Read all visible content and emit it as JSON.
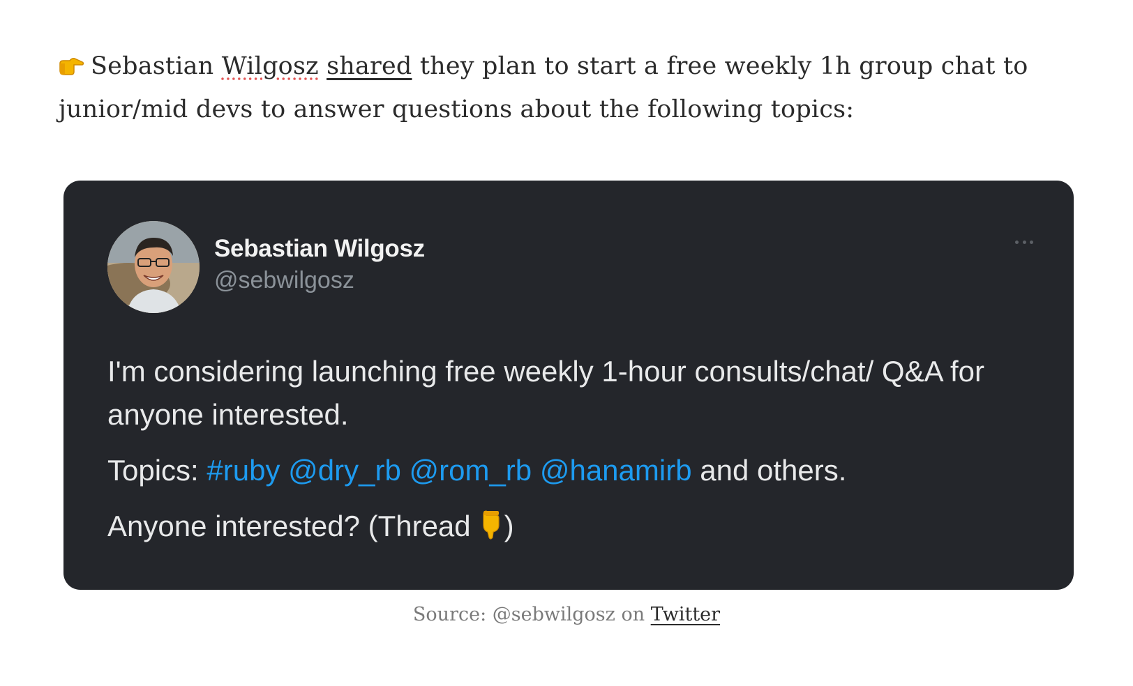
{
  "intro": {
    "pointer_icon": "backhand-index-pointing-right-icon",
    "name": "Sebastian",
    "surname_link": "Wilgosz",
    "shared_link": "shared",
    "text": " they plan to start a free weekly 1h group chat to junior/mid devs to answer questions about the following topics:"
  },
  "tweet": {
    "author_name": "Sebastian Wilgosz",
    "author_handle": "@sebwilgosz",
    "line1": "I'm considering launching free weekly 1-hour consults/chat/ Q&A for anyone interested.",
    "topics_prefix": "Topics: ",
    "tags": [
      "#ruby",
      "@dry_rb",
      "@rom_rb",
      "@hanamirb"
    ],
    "topics_suffix": " and others.",
    "question_text": "Anyone interested? (Thread",
    "question_end": ")",
    "finger_icon": "backhand-index-pointing-down-icon",
    "accent_color": "#1d9bf0",
    "card_color": "#24262b"
  },
  "caption": {
    "prefix": "Source: @sebwilgosz on ",
    "link": "Twitter"
  }
}
